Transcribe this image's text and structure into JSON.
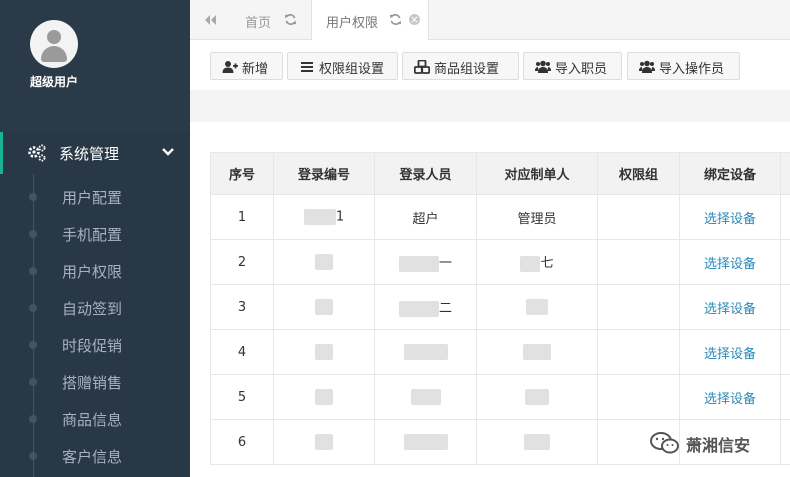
{
  "sidebar": {
    "profile_name": "超级用户",
    "menu_header": "系统管理",
    "items": [
      {
        "label": "用户配置"
      },
      {
        "label": "手机配置"
      },
      {
        "label": "用户权限"
      },
      {
        "label": "自动签到"
      },
      {
        "label": "时段促销"
      },
      {
        "label": "搭赠销售"
      },
      {
        "label": "商品信息"
      },
      {
        "label": "客户信息"
      }
    ],
    "colors": {
      "background": "#2f4050",
      "accent": "#1ab394"
    }
  },
  "tabs": [
    {
      "label": "首页",
      "icon": "refresh-icon"
    },
    {
      "label": "用户权限",
      "icon": "refresh-icon",
      "active": true
    }
  ],
  "toolbar": {
    "add_label": "新增",
    "perm_group_label": "权限组设置",
    "product_group_label": "商品组设置",
    "import_staff_label": "导入职员",
    "import_operator_label": "导入操作员"
  },
  "table": {
    "headers": [
      "序号",
      "登录编号",
      "登录人员",
      "对应制单人",
      "权限组",
      "绑定设备"
    ],
    "rows": [
      {
        "no": "1",
        "login_id": "1",
        "user": "超户",
        "maker": "管理员",
        "group": "",
        "device": "选择设备"
      },
      {
        "no": "2",
        "login_id": "",
        "user": "一",
        "maker": "七",
        "group": "",
        "device": "选择设备"
      },
      {
        "no": "3",
        "login_id": "",
        "user": "二",
        "maker": "",
        "group": "",
        "device": "选择设备"
      },
      {
        "no": "4",
        "login_id": "",
        "user": "",
        "maker": "",
        "group": "",
        "device": "选择设备"
      },
      {
        "no": "5",
        "login_id": "",
        "user": "",
        "maker": "",
        "group": "",
        "device": "选择设备"
      },
      {
        "no": "6",
        "login_id": "",
        "user": "",
        "maker": "",
        "group": "",
        "device": ""
      }
    ],
    "link_color": "#2a8ab8"
  },
  "watermark": "萧湘信安"
}
